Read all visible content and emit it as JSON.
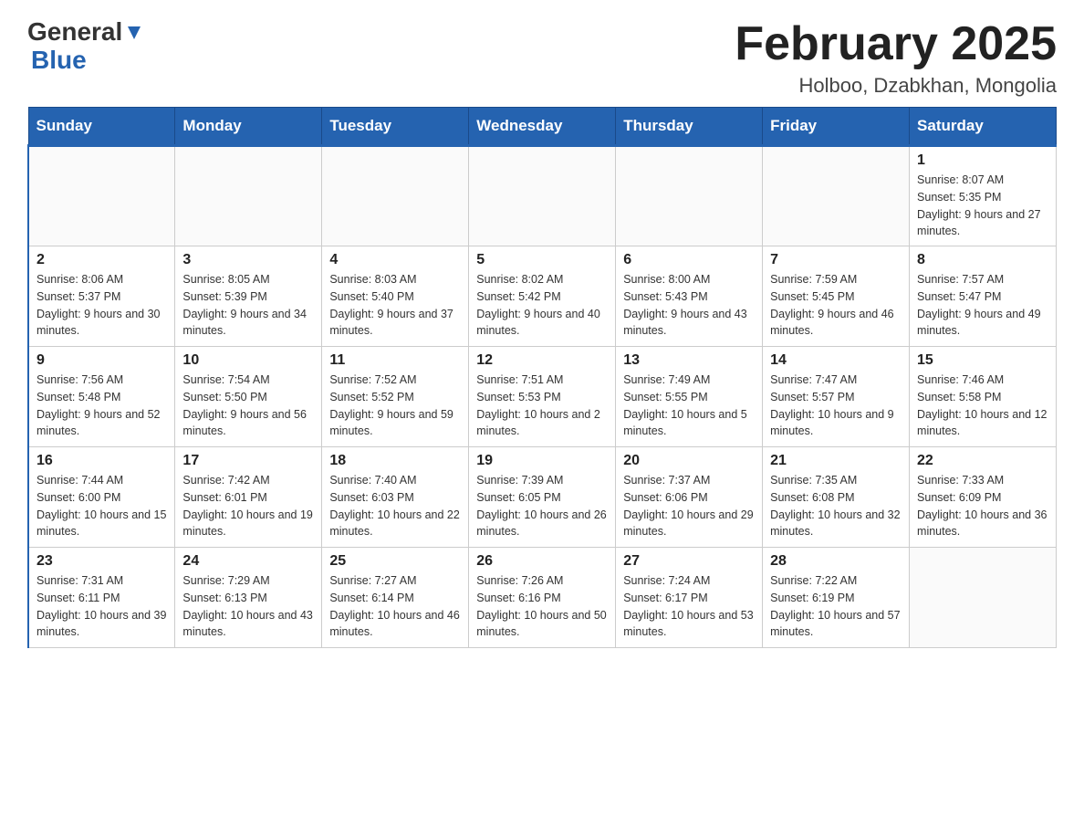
{
  "header": {
    "logo_general": "General",
    "logo_blue": "Blue",
    "title": "February 2025",
    "location": "Holboo, Dzabkhan, Mongolia"
  },
  "days_of_week": [
    "Sunday",
    "Monday",
    "Tuesday",
    "Wednesday",
    "Thursday",
    "Friday",
    "Saturday"
  ],
  "weeks": [
    [
      {
        "day": "",
        "info": ""
      },
      {
        "day": "",
        "info": ""
      },
      {
        "day": "",
        "info": ""
      },
      {
        "day": "",
        "info": ""
      },
      {
        "day": "",
        "info": ""
      },
      {
        "day": "",
        "info": ""
      },
      {
        "day": "1",
        "info": "Sunrise: 8:07 AM\nSunset: 5:35 PM\nDaylight: 9 hours and 27 minutes."
      }
    ],
    [
      {
        "day": "2",
        "info": "Sunrise: 8:06 AM\nSunset: 5:37 PM\nDaylight: 9 hours and 30 minutes."
      },
      {
        "day": "3",
        "info": "Sunrise: 8:05 AM\nSunset: 5:39 PM\nDaylight: 9 hours and 34 minutes."
      },
      {
        "day": "4",
        "info": "Sunrise: 8:03 AM\nSunset: 5:40 PM\nDaylight: 9 hours and 37 minutes."
      },
      {
        "day": "5",
        "info": "Sunrise: 8:02 AM\nSunset: 5:42 PM\nDaylight: 9 hours and 40 minutes."
      },
      {
        "day": "6",
        "info": "Sunrise: 8:00 AM\nSunset: 5:43 PM\nDaylight: 9 hours and 43 minutes."
      },
      {
        "day": "7",
        "info": "Sunrise: 7:59 AM\nSunset: 5:45 PM\nDaylight: 9 hours and 46 minutes."
      },
      {
        "day": "8",
        "info": "Sunrise: 7:57 AM\nSunset: 5:47 PM\nDaylight: 9 hours and 49 minutes."
      }
    ],
    [
      {
        "day": "9",
        "info": "Sunrise: 7:56 AM\nSunset: 5:48 PM\nDaylight: 9 hours and 52 minutes."
      },
      {
        "day": "10",
        "info": "Sunrise: 7:54 AM\nSunset: 5:50 PM\nDaylight: 9 hours and 56 minutes."
      },
      {
        "day": "11",
        "info": "Sunrise: 7:52 AM\nSunset: 5:52 PM\nDaylight: 9 hours and 59 minutes."
      },
      {
        "day": "12",
        "info": "Sunrise: 7:51 AM\nSunset: 5:53 PM\nDaylight: 10 hours and 2 minutes."
      },
      {
        "day": "13",
        "info": "Sunrise: 7:49 AM\nSunset: 5:55 PM\nDaylight: 10 hours and 5 minutes."
      },
      {
        "day": "14",
        "info": "Sunrise: 7:47 AM\nSunset: 5:57 PM\nDaylight: 10 hours and 9 minutes."
      },
      {
        "day": "15",
        "info": "Sunrise: 7:46 AM\nSunset: 5:58 PM\nDaylight: 10 hours and 12 minutes."
      }
    ],
    [
      {
        "day": "16",
        "info": "Sunrise: 7:44 AM\nSunset: 6:00 PM\nDaylight: 10 hours and 15 minutes."
      },
      {
        "day": "17",
        "info": "Sunrise: 7:42 AM\nSunset: 6:01 PM\nDaylight: 10 hours and 19 minutes."
      },
      {
        "day": "18",
        "info": "Sunrise: 7:40 AM\nSunset: 6:03 PM\nDaylight: 10 hours and 22 minutes."
      },
      {
        "day": "19",
        "info": "Sunrise: 7:39 AM\nSunset: 6:05 PM\nDaylight: 10 hours and 26 minutes."
      },
      {
        "day": "20",
        "info": "Sunrise: 7:37 AM\nSunset: 6:06 PM\nDaylight: 10 hours and 29 minutes."
      },
      {
        "day": "21",
        "info": "Sunrise: 7:35 AM\nSunset: 6:08 PM\nDaylight: 10 hours and 32 minutes."
      },
      {
        "day": "22",
        "info": "Sunrise: 7:33 AM\nSunset: 6:09 PM\nDaylight: 10 hours and 36 minutes."
      }
    ],
    [
      {
        "day": "23",
        "info": "Sunrise: 7:31 AM\nSunset: 6:11 PM\nDaylight: 10 hours and 39 minutes."
      },
      {
        "day": "24",
        "info": "Sunrise: 7:29 AM\nSunset: 6:13 PM\nDaylight: 10 hours and 43 minutes."
      },
      {
        "day": "25",
        "info": "Sunrise: 7:27 AM\nSunset: 6:14 PM\nDaylight: 10 hours and 46 minutes."
      },
      {
        "day": "26",
        "info": "Sunrise: 7:26 AM\nSunset: 6:16 PM\nDaylight: 10 hours and 50 minutes."
      },
      {
        "day": "27",
        "info": "Sunrise: 7:24 AM\nSunset: 6:17 PM\nDaylight: 10 hours and 53 minutes."
      },
      {
        "day": "28",
        "info": "Sunrise: 7:22 AM\nSunset: 6:19 PM\nDaylight: 10 hours and 57 minutes."
      },
      {
        "day": "",
        "info": ""
      }
    ]
  ]
}
